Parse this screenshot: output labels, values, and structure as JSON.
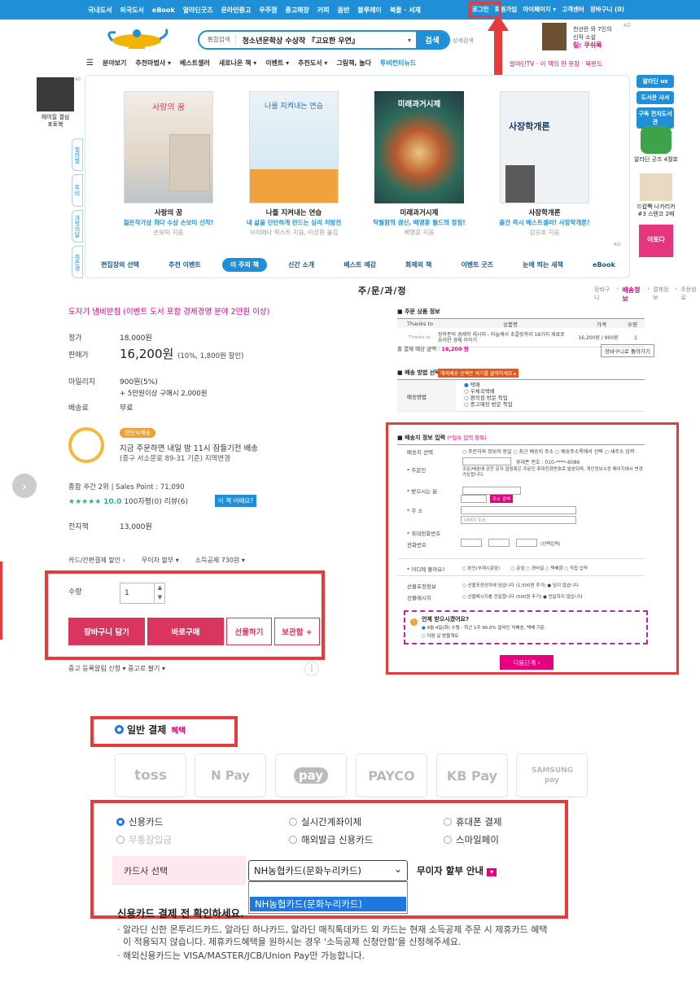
{
  "topnav": {
    "items": [
      "국내도서",
      "외국도서",
      "eBook",
      "알라딘굿즈",
      "온라인중고",
      "우주점",
      "중고매장",
      "커피",
      "음반",
      "블루레이",
      "북플 · 서재"
    ],
    "right": [
      "로그인",
      "회원가입",
      "마이페이지 ▾",
      "고객센터",
      "장바구니 (0)"
    ]
  },
  "header": {
    "search_category": "통합검색",
    "search_query": "청소년문학상 수상작 『고요한 우연』",
    "search_button": "검색",
    "detail_search": "상세검색",
    "ad_line1": "천선란 외 7인의",
    "ad_line2": "신작 소설",
    "ad_title": "림: 쿠쉬룩",
    "ad_tag": "AD"
  },
  "menu": {
    "items": [
      "분야보기",
      "추천마법사 ▾",
      "베스트셀러",
      "새로나온 책 ▾",
      "이벤트 ▾",
      "추천도서 ▾",
      "그림책, 놀다",
      "투비컨티뉴드"
    ],
    "right": "알라딘TV · 이 책의 한 문장 · 북펀드"
  },
  "banner": {
    "left_ad": {
      "line1": "헤어질 결심",
      "line2": "포토북",
      "tag": "AD"
    },
    "vtabs": [
      "철라함",
      "투비",
      "과학의달",
      "취준생"
    ],
    "books": [
      {
        "title": "사랑의 꿈",
        "desc": "젊은작가상 최다 수상 손보미 신작!",
        "author": "손보미 지음"
      },
      {
        "title": "나를 지켜내는 연습",
        "desc": "내 삶을 단단하게 만드는 심리 처방전",
        "author": "브리애나 위스트 지음, 이상원 옮김"
      },
      {
        "title": "미래과거시제",
        "desc": "탁월함의 갱신, 배명훈 월드의 정점!",
        "author": "배명훈 지음"
      },
      {
        "title": "사장학개론",
        "desc": "출간 즉시 베스트셀러! 사장학개론!",
        "author": "김승호 지음"
      }
    ],
    "cover_texts": [
      "사랑의 꿈",
      "나를 지켜내는 연습",
      "미래과거시제",
      "사장학개론"
    ],
    "ad_tag": "AD",
    "tabs": [
      "편집장의 선택",
      "추천 이벤트",
      "이 주의 책",
      "신간 소개",
      "베스트 예감",
      "화제의 책",
      "이벤트 굿즈",
      "눈에 띄는 새책",
      "eBook"
    ],
    "active_tab": 2
  },
  "rightnav": {
    "buttons": [
      "알라딘 us",
      "도서관 사서",
      "구독 전자도서관"
    ],
    "ads": [
      "알라딘 굿즈 4월호",
      "드랍빽 나카리카#3 스텐코 2배",
      "이토다"
    ]
  },
  "steps": {
    "title": "주/문/과/정",
    "right": [
      "장바구니",
      "배송정보",
      "결제정보",
      "주문완료"
    ],
    "active": 1
  },
  "product": {
    "promo": "도자기 냄비받침 (이벤트 도서 포함 경제경영 분야 2만원 이상)",
    "list_price_label": "정가",
    "list_price": "18,000원",
    "sale_label": "판매가",
    "sale_price": "16,200원",
    "sale_note": "(10%, 1,800원 할인)",
    "mileage_label": "마일리지",
    "mileage1": "900원(5%)",
    "mileage2": "+ 5만원이상 구매시 2,000원",
    "shipping_label": "배송료",
    "shipping": "무료",
    "badge": "양탄자배송",
    "delivery1": "지금 주문하면 내일 밤 11시 잠들기전 배송",
    "delivery2": "(중구 서소문로 89-31 기준) 지역변경",
    "rank": "종합 주간 2위 | Sales Point : 71,090",
    "rating": "10.0",
    "reviews": "100자평(0)  리뷰(6)",
    "thisbook": "이 책 어때요?",
    "ebook_label": "전자책",
    "ebook_price": "13,000원",
    "options": [
      "카드/간편결제 할인 ›",
      "무이자 할부 ▾",
      "소득공제 730원 ▾"
    ],
    "qty_label": "수량",
    "qty_value": "1",
    "buttons": [
      "장바구니 담기",
      "바로구매",
      "선물하기",
      "보관함 +"
    ],
    "used": "중고 등록알림 신청 ▾   중고로 팔기 ▾"
  },
  "order": {
    "title": "주문 상품 정보",
    "headers": [
      "Thanks to",
      "상품명",
      "가격",
      "수량"
    ],
    "row": {
      "thanks": "Thanks to",
      "name": "장하준의 경제학 레시피 - 마늘에서 초콜릿까지 18가지 재료로 요리한 경제 이야기",
      "price": "16,200원 / 900원",
      "qty": "1"
    },
    "total": "총 결제 예상 금액 : ",
    "total_value": "16,200 원",
    "cart_back": "장바구니로 돌아가기",
    "ship_method": "배송 방법 선택",
    "ship_badge": "해외배송 선택은 여기를 클릭하세요 ▸",
    "ship_label": "배송방법",
    "ship_options": [
      "택배",
      "우체국택배",
      "편의점 방문 픽업",
      "중고매장 방문 픽업"
    ],
    "form_title": "배송지 정보 입력",
    "form_req": "(*필수 입력 항목)",
    "fields": {
      "select": "배송지 선택",
      "select_opts": "○ 주문자와 정보와 동일  ○ 최근 배송지 주소  ○ 배송주소록에서 선택  ○ 새주소 입력",
      "orderer": "* 주문인",
      "orderer_note": "휴대폰 번호 : 010-****-6086",
      "orderer_note2": "주문/배송에 관한 문자 알림톡은 주문인 휴대전화번호로 발송되며, 개인정보수정 페이지에서 변경 가능합니다.",
      "receiver": "* 받으시는 분",
      "address": "* 주 소",
      "addr_btn": "주소 검색",
      "addr_rest": "나머지 주소",
      "mobile": "* 휴대전화번호",
      "phone": "전화번호",
      "phone_opt": "(선택입력)",
      "where": "* 어디에 둘까요?",
      "where_opts": "○ 문앞  ○ 경비실  ○ 택배함  ○ 직접 입력",
      "where_opts2": "○ 본인(부재시문앞)",
      "gift_pack": "선물포장정보",
      "gift_pack_opts": "○ 선물포장상자에 담습니다 (1,500원 추가)  ● 담지 않습니다",
      "gift_msg": "선물메시지",
      "gift_msg_opts": "○ 선물메시지를 전달합니다 (500원 추가)  ● 전달하지 않습니다"
    },
    "when_title": "언제 받으시겠어요?",
    "when_opt1": "4월 4일(화) 수령 - 최근 1주 90.0% 알라딘 익배송, 택배 기준",
    "when_opt2": "다음 날 받을게요",
    "next": "다음단계 ›"
  },
  "payment": {
    "general": "일반 결제",
    "benefit": "혜택",
    "logos": [
      "toss",
      "N Pay",
      "pay",
      "PAYCO",
      "KB Pay",
      "SAMSUNG pay"
    ],
    "methods": [
      "신용카드",
      "실시간계좌이체",
      "휴대폰 결제",
      "무통장입금",
      "해외발급 신용카드",
      "스마일페이"
    ],
    "card_label": "카드사 선택",
    "card_value": "NH농협카드(문화누리카드)",
    "card_option": "NH농협카드(문화누리카드)",
    "interest": "무이자 할부 안내",
    "confirm": "신용카드 결제 전 확인하세요.",
    "notes": [
      "· 알라딘 신한 몬투리드카드, 알라딘 하나카드, 알라딘 매직톡데카드 외 카드는 현재 소득공제 주문 시 제휴카드 혜택",
      "  이 적용되지 않습니다. 제휴카드혜택을 원하시는 경우 '소득공제 신청안함'을 신청해주세요.",
      "· 해외신용카드는 VISA/MASTER/JCB/Union Pay만 가능합니다."
    ]
  },
  "colors": {
    "primary": "#1f8fd8",
    "pink": "#e5007e",
    "red_box": "#e53b3b"
  }
}
